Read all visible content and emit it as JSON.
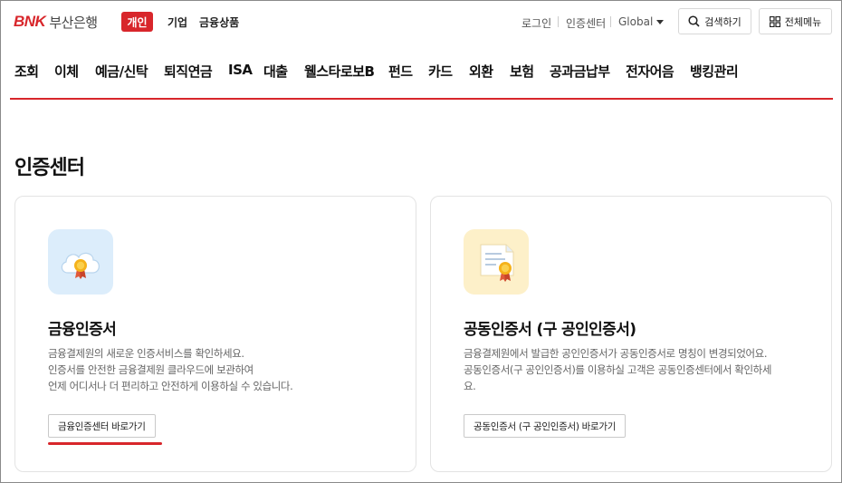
{
  "header": {
    "logo_mark": "BNK",
    "logo_text": "부산은행",
    "segments": [
      "개인",
      "기업",
      "금융상품"
    ],
    "util_links": [
      "로그인",
      "인증센터",
      "Global"
    ],
    "search_label": "검색하기",
    "menu_label": "전체메뉴"
  },
  "nav": {
    "items": [
      "조회",
      "이체",
      "예금/신탁",
      "퇴직연금",
      "ISA",
      "대출",
      "웰스타로보B",
      "펀드",
      "카드",
      "외환",
      "보험",
      "공과금납부",
      "전자어음",
      "뱅킹관리"
    ]
  },
  "page": {
    "title": "인증센터"
  },
  "cards": [
    {
      "title": "금융인증서",
      "desc": [
        "금융결제원의 새로운 인증서비스를 확인하세요.",
        "인증서를 안전한 금융결제원 클라우드에 보관하여",
        "언제 어디서나 더 편리하고 안전하게 이용하실 수 있습니다."
      ],
      "button": "금융인증센터 바로가기",
      "icon": "cloud-certificate-icon",
      "icon_bg": "#dcedfb"
    },
    {
      "title": "공동인증서 (구 공인인증서)",
      "desc": [
        "금융결제원에서 발급한 공인인증서가 공동인증서로 명칭이 변경되었어요.",
        "공동인증서(구 공인인증서)를 이용하실 고객은 공동인증센터에서 확인하세",
        "요."
      ],
      "button": "공동인증서 (구 공인인증서) 바로가기",
      "icon": "document-certificate-icon",
      "icon_bg": "#fdf0c9"
    }
  ],
  "colors": {
    "brand": "#d8262b"
  }
}
